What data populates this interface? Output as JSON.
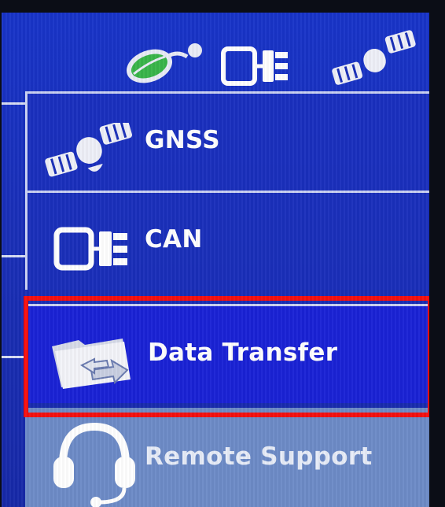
{
  "status_bar": {
    "icons": [
      "leaf-antenna-icon",
      "can-bus-icon",
      "satellite-icon"
    ]
  },
  "menu": {
    "items": [
      {
        "label": "GNSS",
        "icon": "satellite-icon"
      },
      {
        "label": "CAN",
        "icon": "can-bus-icon"
      },
      {
        "label": "Data Transfer",
        "icon": "folder-transfer-icon",
        "selected": true
      },
      {
        "label": "Remote Support",
        "icon": "headset-icon",
        "disabled": true
      }
    ]
  },
  "colors": {
    "screen_blue": "#1a2fb8",
    "selected_item": "#1a22d6",
    "disabled_item": "#6d8bc7",
    "highlight_border": "#f50f0f"
  }
}
